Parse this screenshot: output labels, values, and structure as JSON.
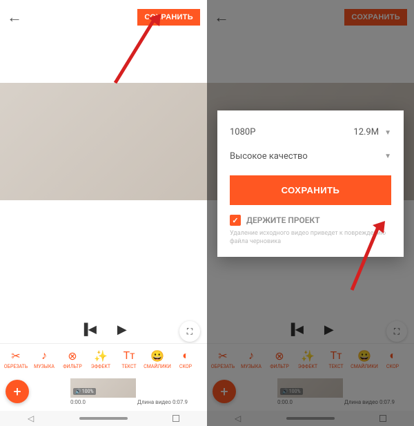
{
  "left": {
    "save_label": "СОХРАНИТЬ",
    "tools": [
      {
        "label": "ОБРЕЗАТЬ",
        "icon": "✂"
      },
      {
        "label": "МУЗЫКА",
        "icon": "♪"
      },
      {
        "label": "ФИЛЬТР",
        "icon": "⊗"
      },
      {
        "label": "ЭФФЕКТ",
        "icon": "✨"
      },
      {
        "label": "ТЕКСТ",
        "icon": "Tᴛ"
      },
      {
        "label": "СМАЙЛИКИ",
        "icon": "😀"
      },
      {
        "label": "СКОР",
        "icon": "◐"
      }
    ],
    "volume": "100%",
    "time_start": "0:00.0",
    "length_label": "Длина видео 0:07.9",
    "add_label": "+"
  },
  "right": {
    "save_label": "СОХРАНИТЬ",
    "tools": [
      {
        "label": "ОБРЕЗАТЬ",
        "icon": "✂"
      },
      {
        "label": "МУЗЫКА",
        "icon": "♪"
      },
      {
        "label": "ФИЛЬТР",
        "icon": "⊗"
      },
      {
        "label": "ЭФФЕКТ",
        "icon": "✨"
      },
      {
        "label": "ТЕКСТ",
        "icon": "Tᴛ"
      },
      {
        "label": "СМАЙЛИКИ",
        "icon": "😀"
      },
      {
        "label": "СКОР",
        "icon": "◐"
      }
    ],
    "volume": "100%",
    "time_start": "0:00.0",
    "length_label": "Длина видео 0:07.9",
    "add_label": "+",
    "dialog": {
      "resolution": "1080P",
      "size": "12.9M",
      "quality": "Высокое качество",
      "save_label": "СОХРАНИТЬ",
      "keep_project": "ДЕРЖИТЕ ПРОЕКТ",
      "note": "Удаление исходного видео приведет к повреждению файла черновика"
    }
  }
}
